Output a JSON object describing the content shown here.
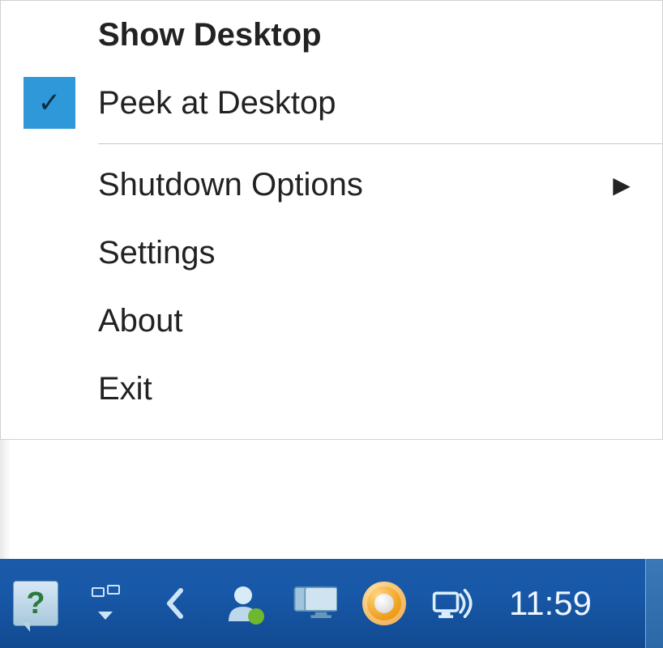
{
  "menu": {
    "items": [
      {
        "label": "Show Desktop",
        "bold": true,
        "checked": false,
        "hasSubmenu": false
      },
      {
        "label": "Peek at Desktop",
        "bold": false,
        "checked": true,
        "hasSubmenu": false
      },
      {
        "label": "Shutdown Options",
        "bold": false,
        "checked": false,
        "hasSubmenu": true
      },
      {
        "label": "Settings",
        "bold": false,
        "checked": false,
        "hasSubmenu": false
      },
      {
        "label": "About",
        "bold": false,
        "checked": false,
        "hasSubmenu": false
      },
      {
        "label": "Exit",
        "bold": false,
        "checked": false,
        "hasSubmenu": false
      }
    ]
  },
  "taskbar": {
    "clock": "11:59",
    "tray": [
      {
        "name": "help-icon"
      },
      {
        "name": "overflow-icon"
      },
      {
        "name": "chevron-left-icon"
      },
      {
        "name": "person-icon"
      },
      {
        "name": "monitor-icon"
      },
      {
        "name": "circle-app-icon"
      },
      {
        "name": "network-volume-icon"
      }
    ]
  }
}
